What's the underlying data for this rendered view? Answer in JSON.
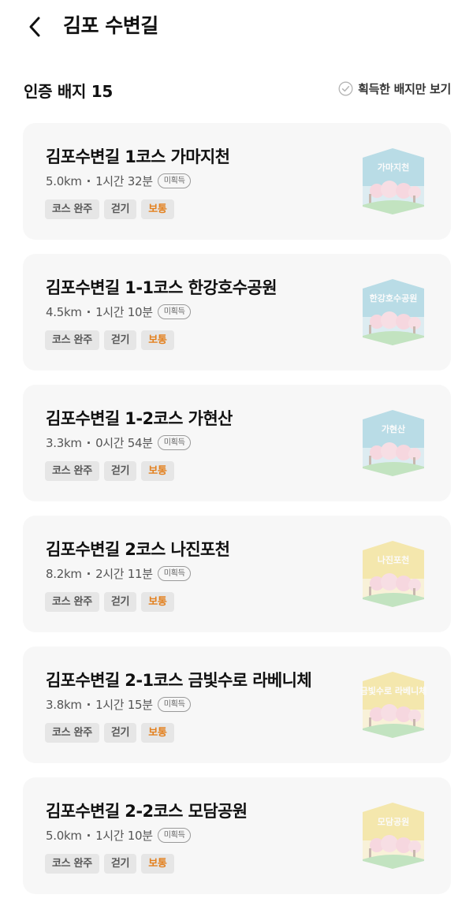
{
  "header": {
    "title": "김포 수변길"
  },
  "summary": {
    "badge_count_label": "인증 배지 15",
    "filter_label": "획득한 배지만 보기"
  },
  "courses": [
    {
      "title": "김포수변길 1코스 가마지천",
      "distance": "5.0km",
      "duration": "1시간 32분",
      "status": "미획득",
      "tags": [
        "코스 완주",
        "걷기",
        "보통"
      ],
      "badge_text": "가마지천",
      "badge_color": "#7cc2d6"
    },
    {
      "title": "김포수변길 1-1코스 한강호수공원",
      "distance": "4.5km",
      "duration": "1시간 10분",
      "status": "미획득",
      "tags": [
        "코스 완주",
        "걷기",
        "보통"
      ],
      "badge_text": "한강호수공원",
      "badge_color": "#7cc2d6"
    },
    {
      "title": "김포수변길 1-2코스 가현산",
      "distance": "3.3km",
      "duration": "0시간 54분",
      "status": "미획득",
      "tags": [
        "코스 완주",
        "걷기",
        "보통"
      ],
      "badge_text": "가현산",
      "badge_color": "#7cc2d6"
    },
    {
      "title": "김포수변길 2코스 나진포천",
      "distance": "8.2km",
      "duration": "2시간 11분",
      "status": "미획득",
      "tags": [
        "코스 완주",
        "걷기",
        "보통"
      ],
      "badge_text": "나진포천",
      "badge_color": "#f3d866"
    },
    {
      "title": "김포수변길 2-1코스 금빛수로 라베니체",
      "distance": "3.8km",
      "duration": "1시간 15분",
      "status": "미획득",
      "tags": [
        "코스 완주",
        "걷기",
        "보통"
      ],
      "badge_text": "금빛수로 라베니체",
      "badge_color": "#f3d866"
    },
    {
      "title": "김포수변길 2-2코스 모담공원",
      "distance": "5.0km",
      "duration": "1시간 10분",
      "status": "미획득",
      "tags": [
        "코스 완주",
        "걷기",
        "보통"
      ],
      "badge_text": "모담공원",
      "badge_color": "#f3d866"
    }
  ],
  "colors": {
    "level_tag": "#e3801e",
    "card_bg": "#f7f7f7",
    "badge_blue": "#7cc2d6",
    "badge_yellow": "#f3d866"
  },
  "icons": {
    "back": "chevron-left-icon",
    "filter": "check-circle-icon"
  }
}
